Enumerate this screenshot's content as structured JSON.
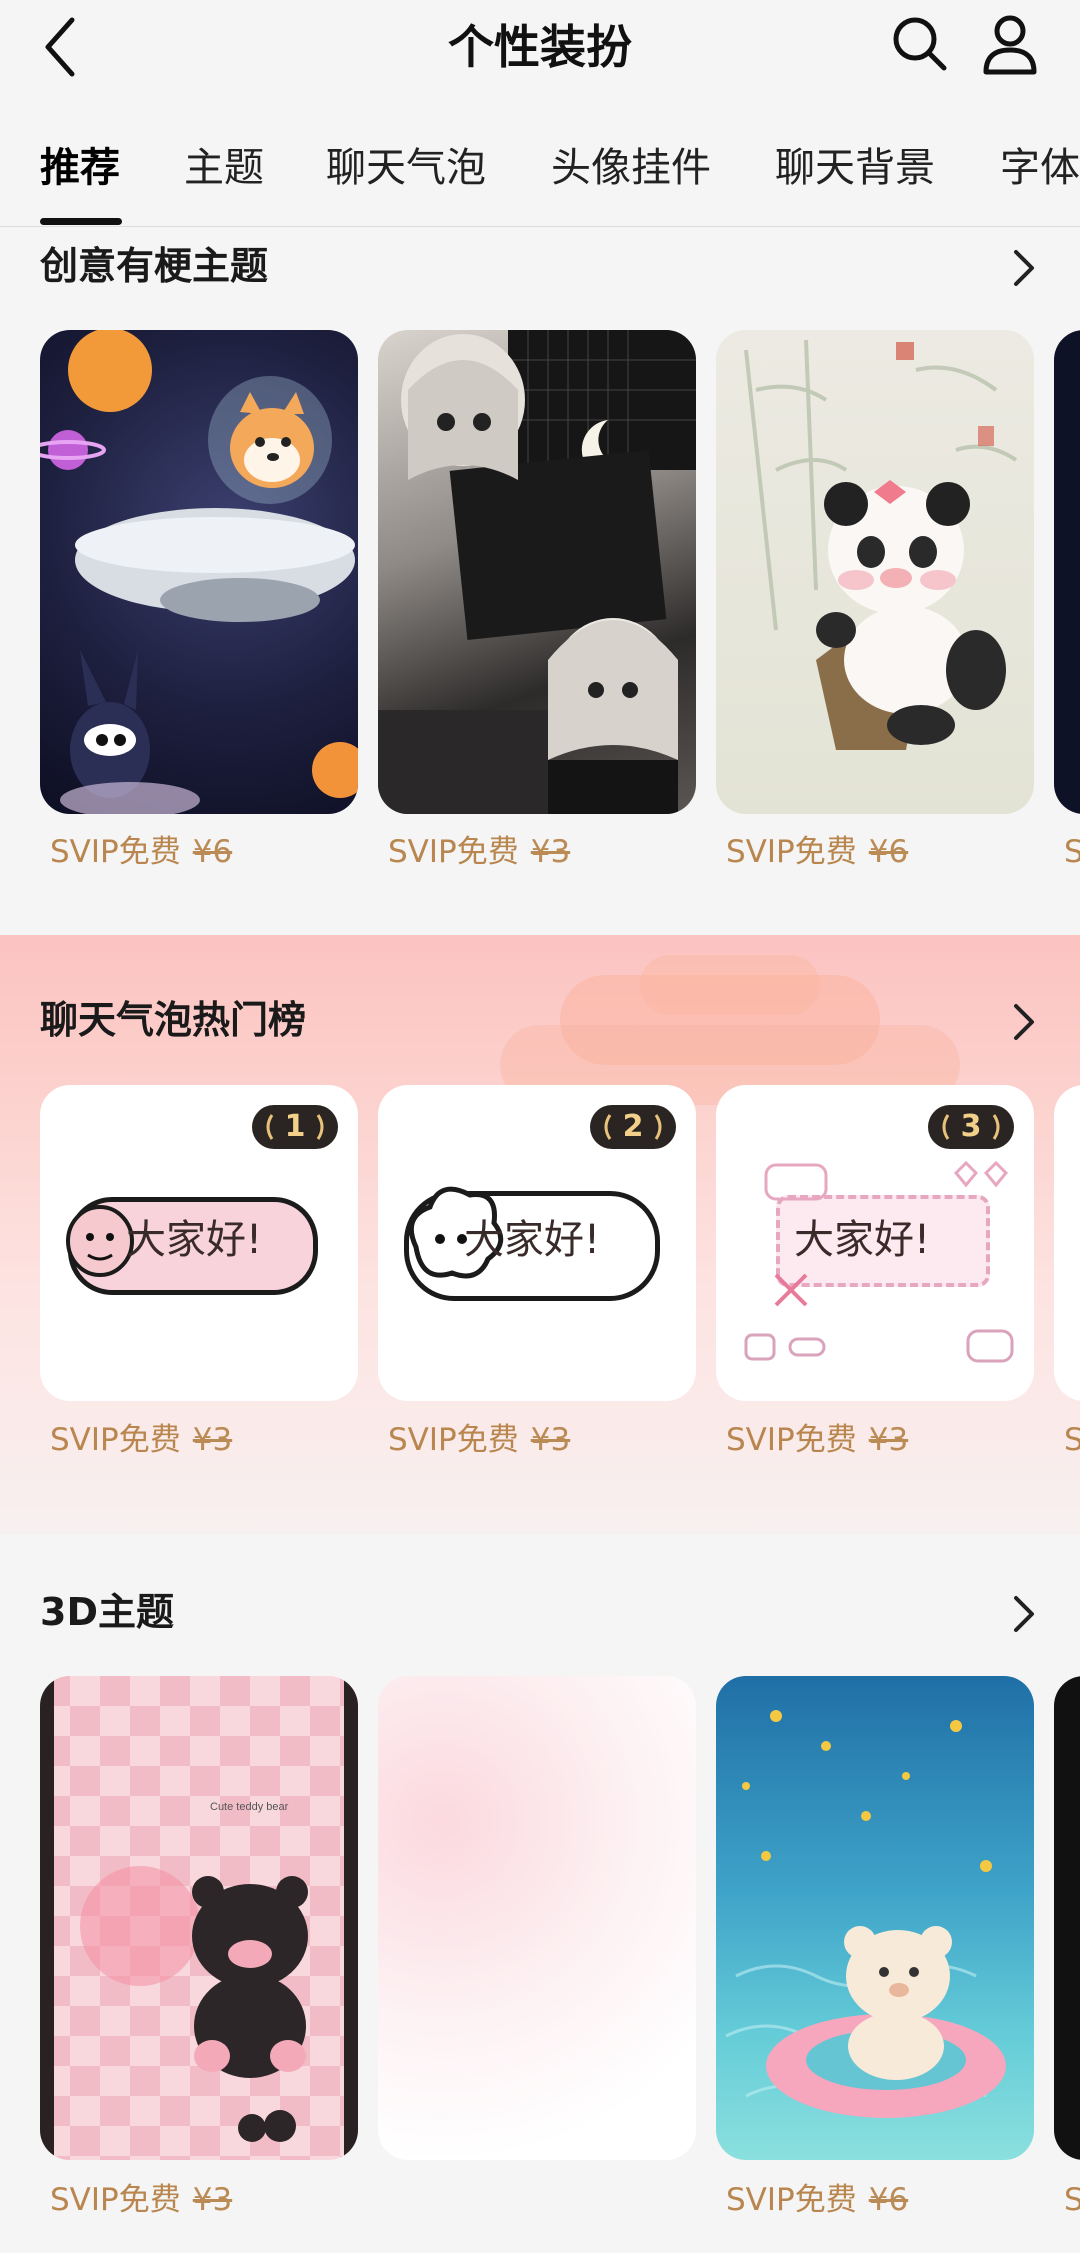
{
  "header": {
    "title": "个性装扮"
  },
  "tabs": [
    {
      "label": "推荐",
      "active": true
    },
    {
      "label": "主题"
    },
    {
      "label": "聊天气泡"
    },
    {
      "label": "头像挂件"
    },
    {
      "label": "聊天背景"
    },
    {
      "label": "字体"
    }
  ],
  "sections": {
    "creative": {
      "title": "创意有梗主题",
      "items": [
        {
          "svip": "SVIP免费",
          "price": "¥6"
        },
        {
          "svip": "SVIP免费",
          "price": "¥3"
        },
        {
          "svip": "SVIP免费",
          "price": "¥6"
        },
        {
          "svip": "S"
        }
      ]
    },
    "bubbles": {
      "title": "聊天气泡热门榜",
      "bubble_text": "大家好!",
      "items": [
        {
          "rank": "1",
          "svip": "SVIP免费",
          "price": "¥3"
        },
        {
          "rank": "2",
          "svip": "SVIP免费",
          "price": "¥3"
        },
        {
          "rank": "3",
          "svip": "SVIP免费",
          "price": "¥3"
        },
        {
          "svip": "S"
        }
      ]
    },
    "three_d": {
      "title": "3D主题",
      "card1_text": "Cute teddy bear",
      "items": [
        {
          "svip": "SVIP免费",
          "price": "¥3"
        },
        {
          "svip": "",
          "price": ""
        },
        {
          "svip": "SVIP免费",
          "price": "¥6"
        },
        {
          "svip": "S"
        }
      ]
    }
  },
  "colors": {
    "price": "#b8864e",
    "badge": "#2a2522",
    "background": "#f5f5f5"
  }
}
